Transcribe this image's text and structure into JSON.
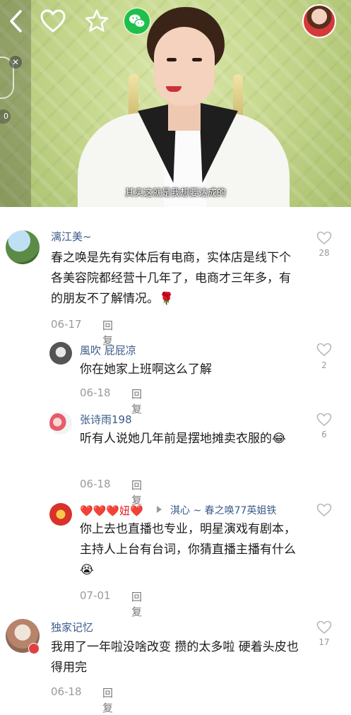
{
  "video": {
    "subtitle": "其实这就是我想要达成的",
    "side_count": "0"
  },
  "icons": {
    "back": "chevron-left-icon",
    "favorite": "heart-outline-icon",
    "star": "star-outline-icon",
    "share": "wechat-icon",
    "close": "close-icon",
    "like": "heart-outline-icon"
  },
  "colors": {
    "name_link": "#3a5a8a",
    "wechat_green": "#1fbf4b",
    "heart_red": "#e02020"
  },
  "comments": [
    {
      "name": "漓江美~",
      "text": "春之唤是先有实体后有电商，实体店是线下个各美容院都经营十几年了，电商才三年多，有的朋友不了解情况。🌹",
      "date": "06-17",
      "reply": "回复",
      "likes": "28"
    },
    {
      "name": "風吹 屁屁凉",
      "text": "你在她家上班啊这么了解",
      "date": "06-18",
      "reply": "回复",
      "likes": "2"
    },
    {
      "name": "张诗雨198",
      "text": "听有人说她几年前是摆地摊卖衣服的😂",
      "date": "06-18",
      "reply": "回复",
      "likes": "6"
    },
    {
      "name": "❤️❤️❤️妞❤️",
      "reply_to": "淇心 ~ 春之唤77英姐铁",
      "text": "你上去也直播也专业，明星演戏有剧本，主持人上台有台词，你猜直播主播有什么😭",
      "date": "07-01",
      "reply": "回复",
      "likes": ""
    },
    {
      "name": "独家记忆",
      "text": "我用了一年啦没啥改变  攒的太多啦  硬着头皮也得用完",
      "date": "06-18",
      "reply": "回复",
      "likes": "17"
    }
  ]
}
